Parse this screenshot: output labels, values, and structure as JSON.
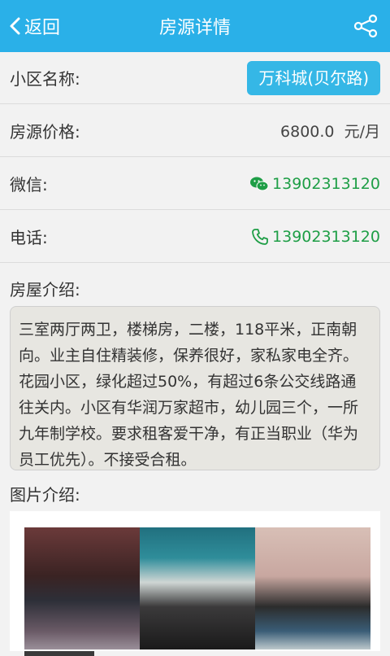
{
  "header": {
    "back_label": "返回",
    "title": "房源详情",
    "share_icon": "share-icon"
  },
  "fields": {
    "community": {
      "label": "小区名称:",
      "value": "万科城(贝尔路)"
    },
    "price": {
      "label": "房源价格:",
      "value": "6800.0  元/月"
    },
    "wechat": {
      "label": "微信:",
      "value": "13902313120",
      "icon": "wechat-icon"
    },
    "phone": {
      "label": "电话:",
      "value": "13902313120",
      "icon": "phone-icon"
    }
  },
  "intro": {
    "label": "房屋介绍:",
    "text": "三室两厅两卫，楼梯房，二楼，118平米，正南朝向。业主自住精装修，保养很好，家私家电全齐。花园小区，绿化超过50%，有超过6条公交线路通往关内。小区有华润万家超市，幼儿园三个，一所九年制学校。要求租客爱干净，有正当职业（华为员工优先）。不接受合租。"
  },
  "photos": {
    "label": "图片介绍:"
  },
  "colors": {
    "header_bg": "#2ab0e8",
    "tag_bg": "#35b7e6",
    "contact_green": "#1e9e46"
  }
}
